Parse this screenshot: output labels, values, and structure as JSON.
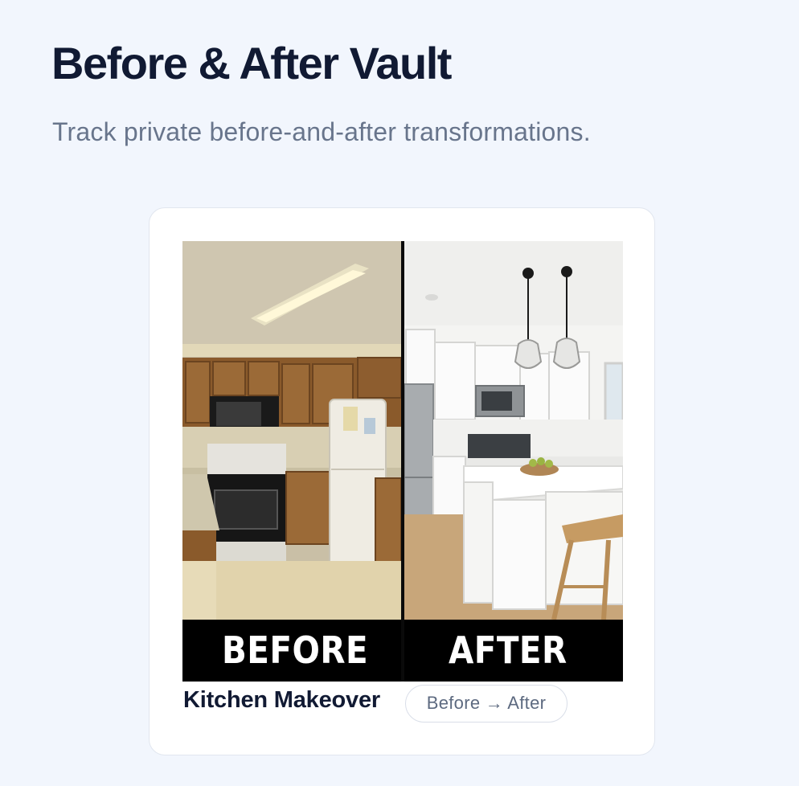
{
  "header": {
    "title": "Before & After Vault",
    "subtitle": "Track private before-and-after transformations."
  },
  "project": {
    "title": "Kitchen Makeover",
    "status": "Before → After",
    "image": {
      "before_label": "BEFORE",
      "after_label": "AFTER"
    }
  },
  "colors": {
    "background": "#f2f6fd",
    "heading": "#111a33",
    "muted": "#68758c",
    "card": "#ffffff",
    "card_border": "#e1e6ef"
  },
  "icons": [
    "arrow-right-icon"
  ]
}
